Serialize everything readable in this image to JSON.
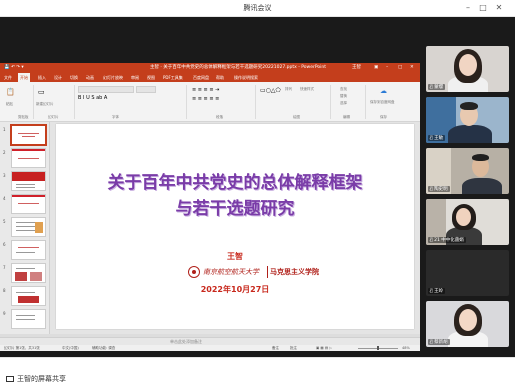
{
  "window": {
    "title": "腾讯会议",
    "min_icon": "minimize-icon",
    "max_icon": "maximize-icon",
    "close_icon": "close-icon"
  },
  "powerpoint": {
    "title": "主智 · 关于百年中共党史的总体解释框架与若干选题研究20221027.pptx - PowerPoint",
    "user": "王智",
    "tabs": [
      "文件",
      "开始",
      "插入",
      "设计",
      "切换",
      "动画",
      "幻灯片放映",
      "审阅",
      "视图",
      "PDF工具集",
      "百度网盘",
      "帮助",
      "操作说明搜索"
    ],
    "active_tab": "开始",
    "ribbon_groups": [
      "剪贴板",
      "幻灯片",
      "字体",
      "段落",
      "绘图",
      "编辑",
      "保存"
    ],
    "ribbon_labels": {
      "paste": "粘贴",
      "new_slide": "新建幻灯片",
      "save_to": "保存到百度网盘",
      "arrange": "排列",
      "styles": "快速样式",
      "find": "查找",
      "replace": "替换",
      "select": "选择"
    },
    "thumbnail_numbers": [
      "1",
      "2",
      "3",
      "4",
      "5",
      "6",
      "7",
      "8",
      "9"
    ],
    "slide": {
      "title_line1": "关于百年中共党史的总体解释框架",
      "title_line2": "与若干选题研究",
      "author": "王智",
      "logo_text_left": "南京航空航天大学",
      "logo_text_right": "马克思主义学院",
      "date": "2022年10月27日"
    },
    "notes_hint": "单击此处添加备注",
    "status": {
      "slide_count": "幻灯片 第1张，共31张",
      "language": "中文(中国)",
      "accessibility": "辅助功能: 调查",
      "notes": "备注",
      "comments": "批注",
      "zoom": "48%"
    }
  },
  "participants": [
    {
      "name": "蒙缨",
      "muted": true
    },
    {
      "name": "王敏",
      "muted": true
    },
    {
      "name": "陶史明",
      "muted": true
    },
    {
      "name": "21 中中化菌娟",
      "muted": true
    },
    {
      "name": "王岭",
      "muted": true
    },
    {
      "name": "蔡新胡",
      "muted": true
    }
  ],
  "share_status": "王智的屏幕共享",
  "colors": {
    "ppt_accent": "#c43e1c",
    "slide_title": "#7a3ca8",
    "slide_red": "#c8281c",
    "dark_bg": "#1a1a1a"
  }
}
